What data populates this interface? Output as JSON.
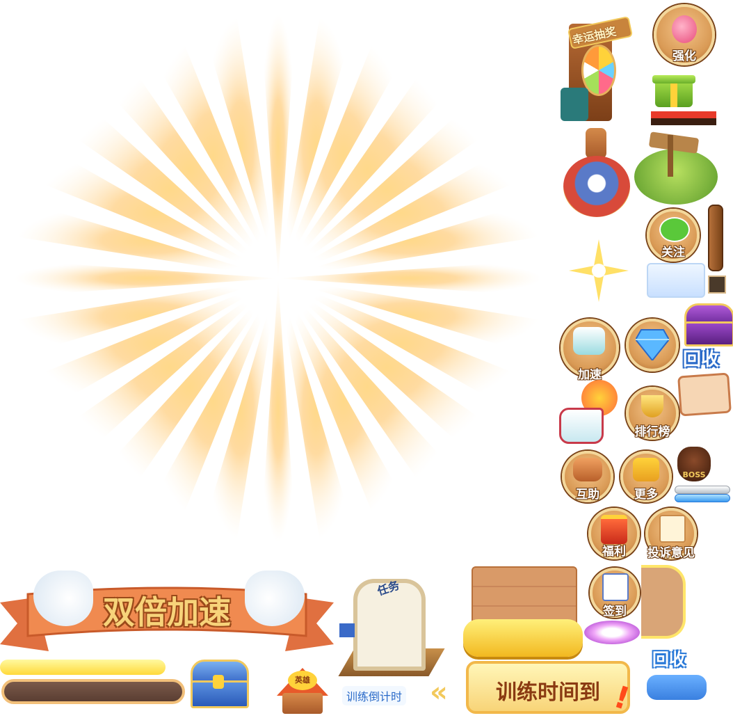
{
  "labels": {
    "lottery": "幸运抽奖",
    "strengthen": "强化",
    "follow": "关注",
    "speedup": "加速",
    "recycle": "回收",
    "ranking": "排行榜",
    "mutual_help": "互助",
    "more": "更多",
    "boss": "BOSS",
    "welfare": "福利",
    "feedback": "投诉意见",
    "signin": "签到",
    "recycle2": "回收",
    "double_speed": "双倍加速",
    "task": "任务",
    "hero": "英雄",
    "training_countdown": "训练倒计时",
    "training_done": "训练时间到"
  },
  "colors": {
    "ribbon": "#e8834a",
    "ribbon_text": "#f7d37a",
    "yellow_bar": "#ffd93a",
    "blue_bar": "#5aa0f0",
    "wood": "#d89a6a"
  }
}
